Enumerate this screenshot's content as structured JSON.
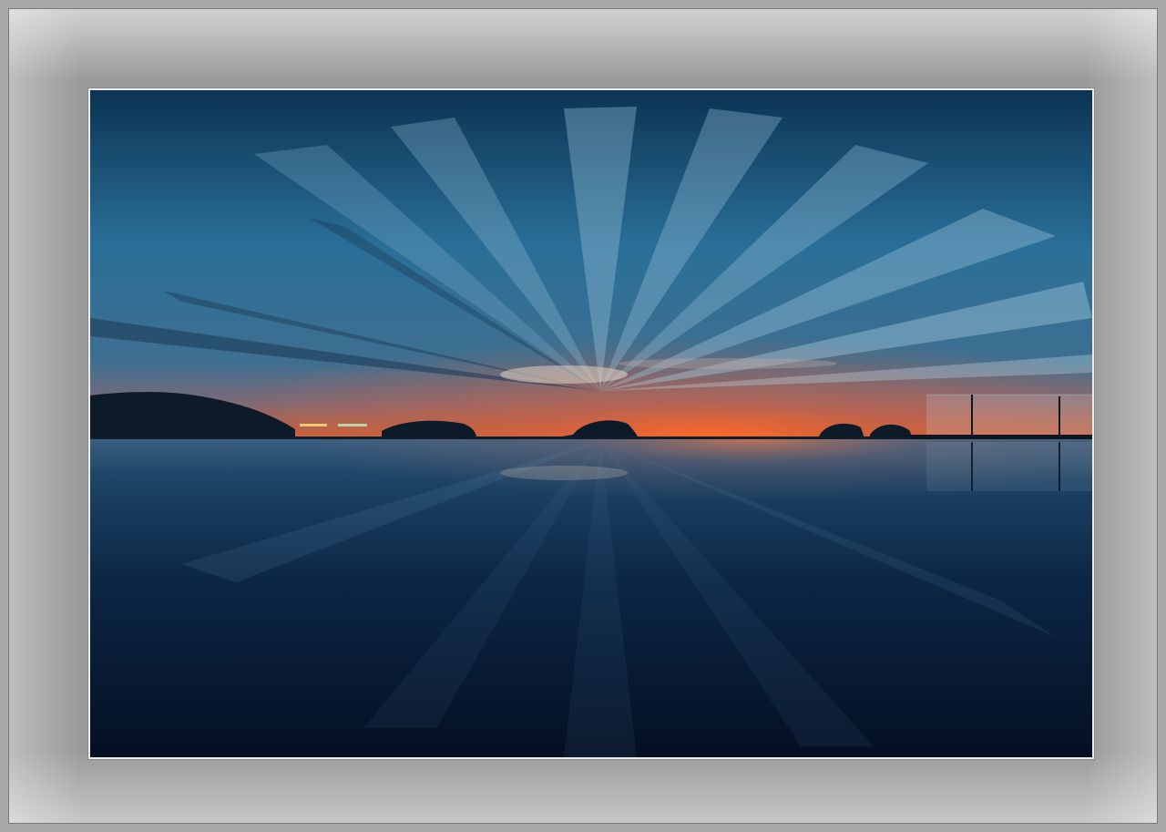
{
  "scene": {
    "subject": "infinity-pool-sunset",
    "colors": {
      "frame": "#9a9a9a",
      "frame_edge": "#a9a9a9",
      "mat_border": "#ececec",
      "sky_top": "#0e3a5c",
      "sky_mid": "#2a74a0",
      "horizon_glow": "#f06a2a",
      "water_dark": "#061225"
    }
  }
}
